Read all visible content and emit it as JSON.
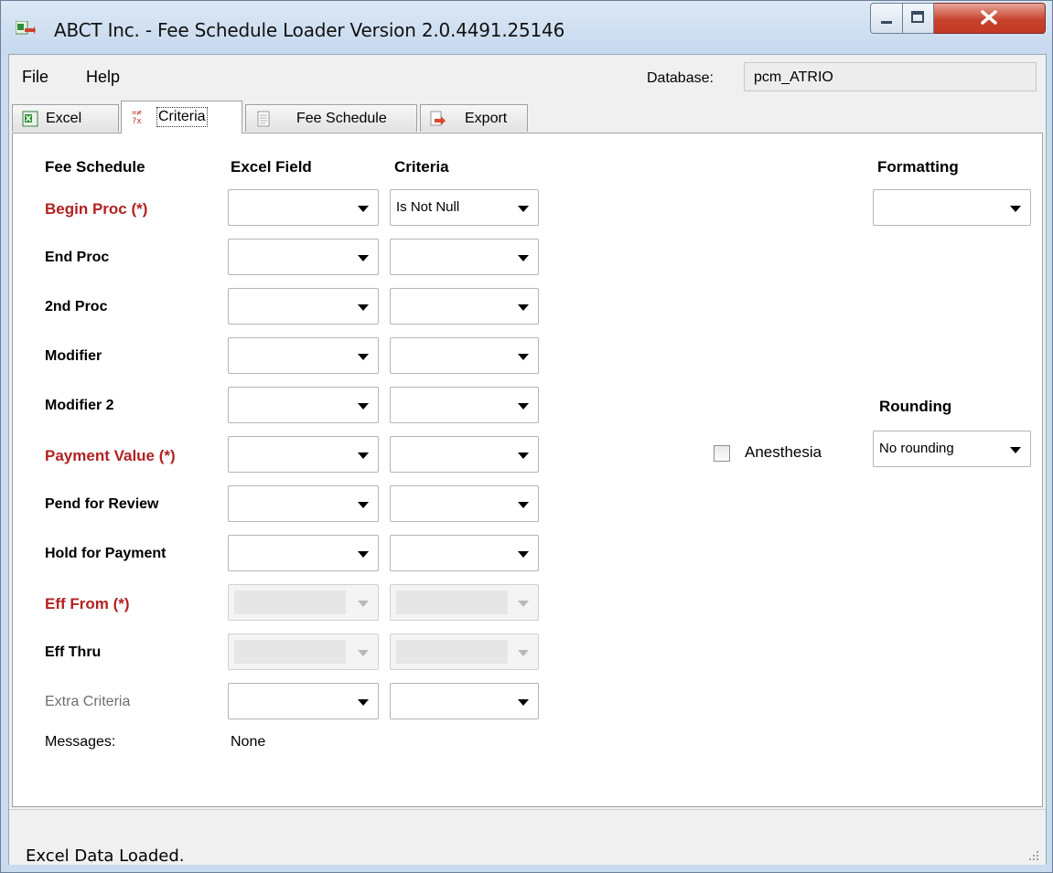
{
  "window": {
    "title": "ABCT Inc. - Fee Schedule Loader Version 2.0.4491.25146",
    "minimize_icon": "minimize-icon",
    "maximize_icon": "maximize-icon",
    "close_icon": "close-icon"
  },
  "menu": {
    "file": "File",
    "help": "Help"
  },
  "database": {
    "label": "Database:",
    "value": "pcm_ATRIO"
  },
  "tabs": [
    {
      "label": "Excel",
      "icon": "excel-icon",
      "active": false
    },
    {
      "label": "Criteria",
      "icon": "criteria-icon",
      "active": true
    },
    {
      "label": "Fee Schedule",
      "icon": "document-icon",
      "active": false
    },
    {
      "label": "Export",
      "icon": "export-icon",
      "active": false
    }
  ],
  "headers": {
    "fee_schedule": "Fee Schedule",
    "excel_field": "Excel Field",
    "criteria": "Criteria",
    "formatting": "Formatting",
    "rounding": "Rounding"
  },
  "rows": [
    {
      "label": "Begin Proc (*)",
      "required": true,
      "excel_field": "",
      "criteria": "Is Not Null",
      "enabled": true
    },
    {
      "label": "End Proc",
      "required": false,
      "excel_field": "",
      "criteria": "",
      "enabled": true
    },
    {
      "label": "2nd Proc",
      "required": false,
      "excel_field": "",
      "criteria": "",
      "enabled": true
    },
    {
      "label": "Modifier",
      "required": false,
      "excel_field": "",
      "criteria": "",
      "enabled": true
    },
    {
      "label": "Modifier 2",
      "required": false,
      "excel_field": "",
      "criteria": "",
      "enabled": true
    },
    {
      "label": "Payment Value (*)",
      "required": true,
      "excel_field": "",
      "criteria": "",
      "enabled": true
    },
    {
      "label": "Pend for Review",
      "required": false,
      "excel_field": "",
      "criteria": "",
      "enabled": true
    },
    {
      "label": "Hold for Payment",
      "required": false,
      "excel_field": "",
      "criteria": "",
      "enabled": true
    },
    {
      "label": "Eff From (*)",
      "required": true,
      "excel_field": "",
      "criteria": "",
      "enabled": false
    },
    {
      "label": "Eff Thru",
      "required": false,
      "excel_field": "",
      "criteria": "",
      "enabled": false
    },
    {
      "label": "Extra Criteria",
      "required": false,
      "excel_field": "",
      "criteria": "",
      "enabled": true
    }
  ],
  "formatting": {
    "value": ""
  },
  "rounding": {
    "value": "No rounding"
  },
  "anesthesia": {
    "label": "Anesthesia",
    "checked": false
  },
  "messages": {
    "label": "Messages:",
    "value": "None"
  },
  "status": {
    "text": "Excel Data Loaded."
  },
  "colors": {
    "required_label": "#b22222",
    "titlebar": "#c9dbee",
    "close_button": "#c8432f"
  }
}
